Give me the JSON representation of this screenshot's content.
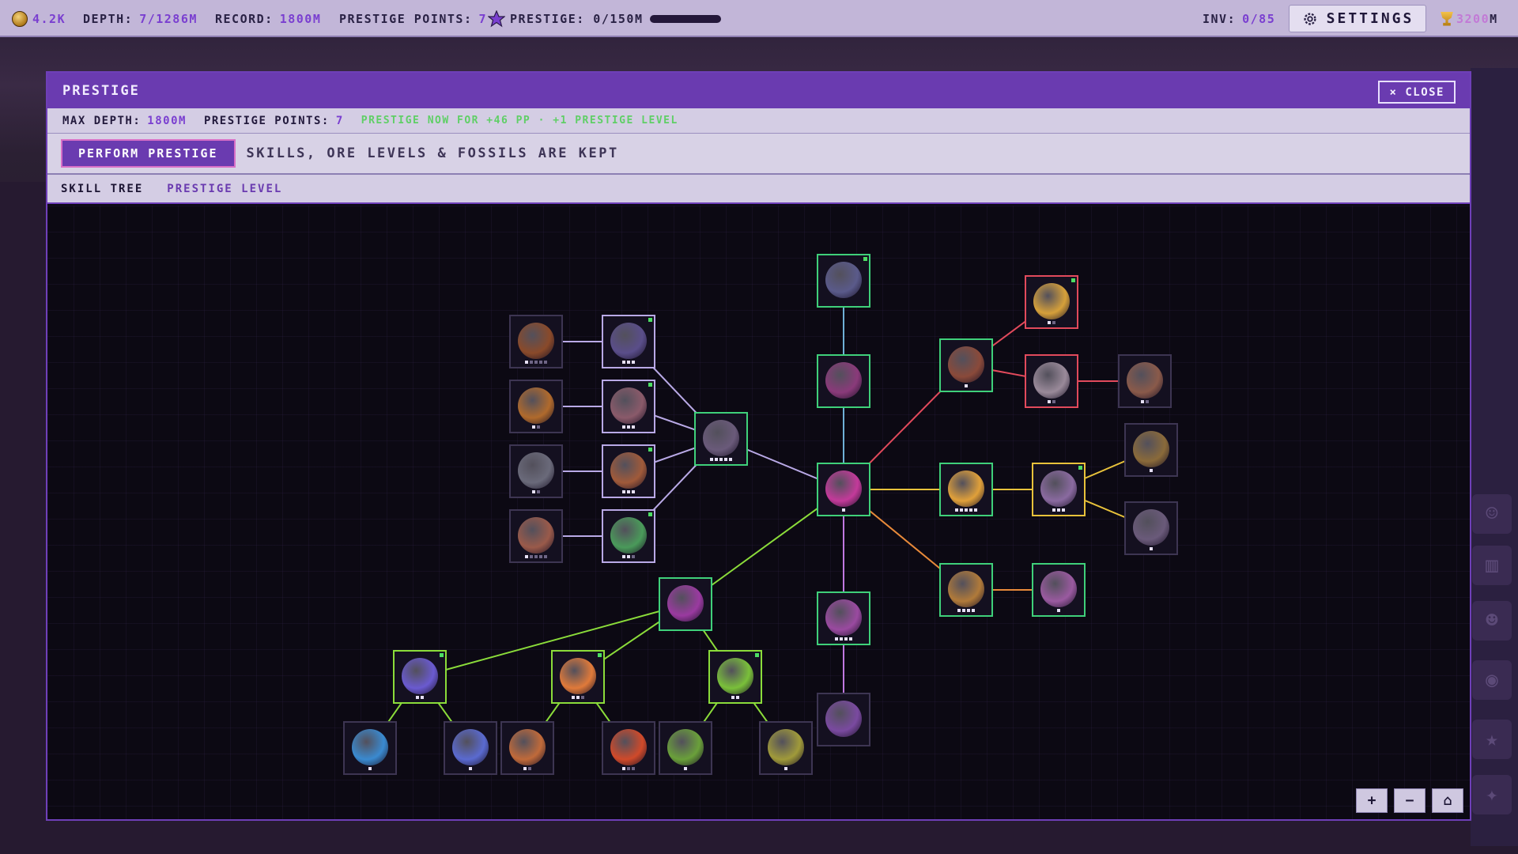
{
  "topbar": {
    "coins": "4.2K",
    "depth_label": "DEPTH:",
    "depth_value": "7/1286M",
    "record_label": "RECORD:",
    "record_value": "1800M",
    "pp_label": "PRESTIGE POINTS:",
    "pp_value": "7",
    "prestige_label": "PRESTIGE: 0/150M",
    "prestige_progress": 0,
    "inv_label": "INV:",
    "inv_value": "0/85",
    "settings_label": "SETTINGS",
    "trophy_value": "3200",
    "trophy_unit": "M"
  },
  "modal": {
    "title": "PRESTIGE",
    "close_label": "× CLOSE",
    "max_depth_label": "MAX DEPTH:",
    "max_depth_value": "1800M",
    "pp_label": "PRESTIGE POINTS:",
    "pp_value": "7",
    "hint": "PRESTIGE NOW FOR +46 PP · +1 PRESTIGE LEVEL",
    "perform_label": "PERFORM PRESTIGE",
    "kept_text": "SKILLS, ORE LEVELS & FOSSILS ARE KEPT",
    "tabs": [
      "SKILL TREE",
      "PRESTIGE LEVEL"
    ],
    "zoom_in": "+",
    "zoom_out": "−",
    "home": "⌂"
  },
  "tree": {
    "nodes": [
      {
        "id": "crossbow",
        "icon": "crossbow-icon",
        "tier": "dim",
        "gem": "#8a4a2a",
        "pips": 5,
        "on": 1,
        "dot": false
      },
      {
        "id": "boots",
        "icon": "boots-icon",
        "tier": "purple",
        "gem": "#5a4e8a",
        "pips": 3,
        "on": 3,
        "dot": true
      },
      {
        "id": "compass",
        "icon": "compass-icon",
        "tier": "dim",
        "gem": "#b06a2c",
        "pips": 2,
        "on": 1,
        "dot": false
      },
      {
        "id": "dna",
        "icon": "dna-icon",
        "tier": "purple",
        "gem": "#8a5a6a",
        "pips": 3,
        "on": 3,
        "dot": true
      },
      {
        "id": "drill-hand",
        "icon": "drill-hand-icon",
        "tier": "dim",
        "gem": "#6a6a7a",
        "pips": 2,
        "on": 1,
        "dot": false
      },
      {
        "id": "backpack",
        "icon": "backpack-icon",
        "tier": "purple",
        "gem": "#a05a3a",
        "pips": 3,
        "on": 3,
        "dot": true
      },
      {
        "id": "gem-pile",
        "icon": "gem-pile-icon",
        "tier": "dim",
        "gem": "#9a5a4a",
        "pips": 5,
        "on": 1,
        "dot": false
      },
      {
        "id": "clover",
        "icon": "clover-icon",
        "tier": "purple",
        "gem": "#4a9a5a",
        "pips": 3,
        "on": 2,
        "dot": true
      },
      {
        "id": "pickaxe",
        "icon": "pickaxe-icon",
        "tier": "green",
        "gem": "#6a5a7a",
        "pips": 5,
        "on": 5,
        "dot": false
      },
      {
        "id": "bomb",
        "icon": "bomb-icon",
        "tier": "green",
        "gem": "#5a5a8a",
        "pips": 0,
        "on": 0,
        "dot": true
      },
      {
        "id": "pentagram",
        "icon": "pentagram-icon",
        "tier": "green",
        "gem": "#8a3a7a",
        "pips": 0,
        "on": 0,
        "dot": false
      },
      {
        "id": "multitool",
        "icon": "multitool-icon",
        "tier": "green",
        "gem": "#c33a9a",
        "pips": 1,
        "on": 1,
        "dot": false
      },
      {
        "id": "spike-orb",
        "icon": "spike-orb-icon",
        "tier": "green",
        "gem": "#9a4aa0",
        "pips": 4,
        "on": 4,
        "dot": false
      },
      {
        "id": "titan",
        "icon": "titan-icon",
        "tier": "dim",
        "gem": "#7a4aa0",
        "pips": 0,
        "on": 0,
        "dot": false
      },
      {
        "id": "laser-eye",
        "icon": "laser-eye-icon",
        "tier": "green",
        "gem": "#8a4a3a",
        "pips": 1,
        "on": 1,
        "dot": false
      },
      {
        "id": "golden-horn",
        "icon": "golden-horn-icon",
        "tier": "red",
        "gem": "#d6a03a",
        "pips": 2,
        "on": 1,
        "dot": true
      },
      {
        "id": "crown",
        "icon": "crown-icon",
        "tier": "red",
        "gem": "#9a8a9a",
        "pips": 2,
        "on": 1,
        "dot": false
      },
      {
        "id": "treasure-chip",
        "icon": "treasure-chip-icon",
        "tier": "dim",
        "gem": "#8a5a4a",
        "pips": 2,
        "on": 1,
        "dot": false
      },
      {
        "id": "ladle",
        "icon": "ladle-icon",
        "tier": "green",
        "gem": "#e0a03a",
        "pips": 5,
        "on": 5,
        "dot": false
      },
      {
        "id": "scales",
        "icon": "scales-icon",
        "tier": "yellow",
        "gem": "#8a6aa0",
        "pips": 3,
        "on": 3,
        "dot": true
      },
      {
        "id": "vortex",
        "icon": "vortex-icon",
        "tier": "dim",
        "gem": "#8a6a3a",
        "pips": 1,
        "on": 1,
        "dot": false
      },
      {
        "id": "shop",
        "icon": "shop-icon",
        "tier": "dim",
        "gem": "#6a5a7a",
        "pips": 1,
        "on": 1,
        "dot": false
      },
      {
        "id": "chest",
        "icon": "chest-icon",
        "tier": "green",
        "gem": "#b07a3a",
        "pips": 4,
        "on": 4,
        "dot": false
      },
      {
        "id": "no-sign",
        "icon": "no-sign-icon",
        "tier": "green",
        "gem": "#9a5aa0",
        "pips": 1,
        "on": 1,
        "dot": false
      },
      {
        "id": "demon-mask",
        "icon": "demon-mask-icon",
        "tier": "green",
        "gem": "#9a3aa0",
        "pips": 0,
        "on": 0,
        "dot": false
      },
      {
        "id": "crystal-pad",
        "icon": "crystal-pad-icon",
        "tier": "lime",
        "gem": "#6a5ad0",
        "pips": 2,
        "on": 2,
        "dot": true
      },
      {
        "id": "gold-pyramid",
        "icon": "gold-pyramid-icon",
        "tier": "lime",
        "gem": "#e07a3a",
        "pips": 3,
        "on": 2,
        "dot": true
      },
      {
        "id": "green-ore",
        "icon": "green-ore-icon",
        "tier": "lime",
        "gem": "#7ac03a",
        "pips": 2,
        "on": 2,
        "dot": true
      },
      {
        "id": "ice-blade",
        "icon": "ice-blade-icon",
        "tier": "dim",
        "gem": "#3a8ad0",
        "pips": 1,
        "on": 1,
        "dot": false
      },
      {
        "id": "sword-gem",
        "icon": "sword-gem-icon",
        "tier": "dim",
        "gem": "#5a6ad0",
        "pips": 1,
        "on": 1,
        "dot": false
      },
      {
        "id": "furnace",
        "icon": "furnace-icon",
        "tier": "dim",
        "gem": "#c06a3a",
        "pips": 2,
        "on": 1,
        "dot": false
      },
      {
        "id": "fire-pit",
        "icon": "fire-pit-icon",
        "tier": "dim",
        "gem": "#d04a2a",
        "pips": 3,
        "on": 1,
        "dot": false
      },
      {
        "id": "virus",
        "icon": "virus-icon",
        "tier": "dim",
        "gem": "#6aa03a",
        "pips": 1,
        "on": 1,
        "dot": false
      },
      {
        "id": "gold-nugget",
        "icon": "gold-nugget-icon",
        "tier": "dim",
        "gem": "#a09a3a",
        "pips": 1,
        "on": 1,
        "dot": false
      }
    ],
    "links": [
      [
        "crossbow",
        "boots",
        "#b9a9e6"
      ],
      [
        "compass",
        "dna",
        "#b9a9e6"
      ],
      [
        "drill-hand",
        "backpack",
        "#b9a9e6"
      ],
      [
        "gem-pile",
        "clover",
        "#b9a9e6"
      ],
      [
        "boots",
        "pickaxe",
        "#b9a9e6"
      ],
      [
        "dna",
        "pickaxe",
        "#b9a9e6"
      ],
      [
        "backpack",
        "pickaxe",
        "#b9a9e6"
      ],
      [
        "clover",
        "pickaxe",
        "#b9a9e6"
      ],
      [
        "pickaxe",
        "multitool",
        "#b9a9e6"
      ],
      [
        "bomb",
        "pentagram",
        "#6fb0d6"
      ],
      [
        "pentagram",
        "multitool",
        "#6fb0d6"
      ],
      [
        "multitool",
        "spike-orb",
        "#c078e0"
      ],
      [
        "spike-orb",
        "titan",
        "#c078e0"
      ],
      [
        "multitool",
        "laser-eye",
        "#e24a5c"
      ],
      [
        "laser-eye",
        "golden-horn",
        "#e24a5c"
      ],
      [
        "laser-eye",
        "crown",
        "#e24a5c"
      ],
      [
        "crown",
        "treasure-chip",
        "#e24a5c"
      ],
      [
        "multitool",
        "ladle",
        "#e8c23b"
      ],
      [
        "ladle",
        "scales",
        "#e8c23b"
      ],
      [
        "scales",
        "vortex",
        "#e8c23b"
      ],
      [
        "scales",
        "shop",
        "#e8c23b"
      ],
      [
        "multitool",
        "chest",
        "#e88a3a"
      ],
      [
        "chest",
        "no-sign",
        "#e88a3a"
      ],
      [
        "multitool",
        "demon-mask",
        "#8bdc3a"
      ],
      [
        "demon-mask",
        "crystal-pad",
        "#8bdc3a"
      ],
      [
        "demon-mask",
        "gold-pyramid",
        "#8bdc3a"
      ],
      [
        "demon-mask",
        "green-ore",
        "#8bdc3a"
      ],
      [
        "crystal-pad",
        "ice-blade",
        "#8bdc3a"
      ],
      [
        "crystal-pad",
        "sword-gem",
        "#8bdc3a"
      ],
      [
        "gold-pyramid",
        "furnace",
        "#8bdc3a"
      ],
      [
        "gold-pyramid",
        "fire-pit",
        "#8bdc3a"
      ],
      [
        "green-ore",
        "virus",
        "#8bdc3a"
      ],
      [
        "green-ore",
        "gold-nugget",
        "#8bdc3a"
      ]
    ]
  }
}
